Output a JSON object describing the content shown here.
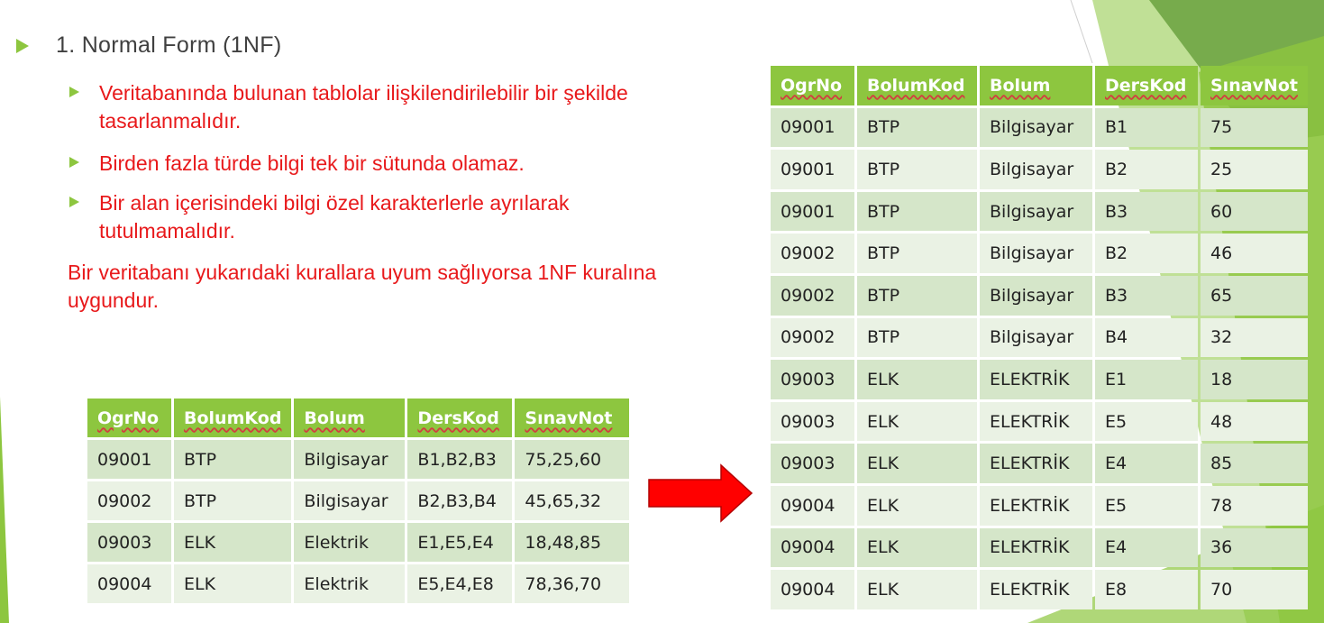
{
  "title": "1. Normal Form (1NF)",
  "bullets": [
    "Veritabanında bulunan tablolar ilişkilendirilebilir bir şekilde tasarlanmalıdır.",
    "Birden fazla türde bilgi tek bir sütunda olamaz.",
    "Bir alan içerisindeki bilgi özel karakterlerle ayrılarak tutulmamalıdır."
  ],
  "conclusion": "Bir veritabanı yukarıdaki kurallara uyum sağlıyorsa 1NF kuralına uygundur.",
  "colors": {
    "accent_green": "#8dc63f",
    "text_red": "#e8191b",
    "row_dark": "#d5e6c9",
    "row_light": "#eaf2e4",
    "arrow_red": "#ff0000"
  },
  "icons": {
    "bullet": "triangle-bullet-icon",
    "arrow": "right-arrow-icon"
  },
  "unnormalized_table": {
    "headers": [
      "OgrNo",
      "BolumKod",
      "Bolum",
      "DersKod",
      "SınavNot"
    ],
    "rows": [
      [
        "09001",
        "BTP",
        "Bilgisayar",
        "B1,B2,B3",
        "75,25,60"
      ],
      [
        "09002",
        "BTP",
        "Bilgisayar",
        "B2,B3,B4",
        "45,65,32"
      ],
      [
        "09003",
        "ELK",
        "Elektrik",
        "E1,E5,E4",
        "18,48,85"
      ],
      [
        "09004",
        "ELK",
        "Elektrik",
        "E5,E4,E8",
        "78,36,70"
      ]
    ]
  },
  "normalized_table": {
    "headers": [
      "OgrNo",
      "BolumKod",
      "Bolum",
      "DersKod",
      "SınavNot"
    ],
    "rows": [
      [
        "09001",
        "BTP",
        "Bilgisayar",
        "B1",
        "75"
      ],
      [
        "09001",
        "BTP",
        "Bilgisayar",
        "B2",
        "25"
      ],
      [
        "09001",
        "BTP",
        "Bilgisayar",
        "B3",
        "60"
      ],
      [
        "09002",
        "BTP",
        "Bilgisayar",
        "B2",
        "46"
      ],
      [
        "09002",
        "BTP",
        "Bilgisayar",
        "B3",
        "65"
      ],
      [
        "09002",
        "BTP",
        "Bilgisayar",
        "B4",
        "32"
      ],
      [
        "09003",
        "ELK",
        "ELEKTRİK",
        "E1",
        "18"
      ],
      [
        "09003",
        "ELK",
        "ELEKTRİK",
        "E5",
        "48"
      ],
      [
        "09003",
        "ELK",
        "ELEKTRİK",
        "E4",
        "85"
      ],
      [
        "09004",
        "ELK",
        "ELEKTRİK",
        "E5",
        "78"
      ],
      [
        "09004",
        "ELK",
        "ELEKTRİK",
        "E4",
        "36"
      ],
      [
        "09004",
        "ELK",
        "ELEKTRİK",
        "E8",
        "70"
      ]
    ]
  }
}
